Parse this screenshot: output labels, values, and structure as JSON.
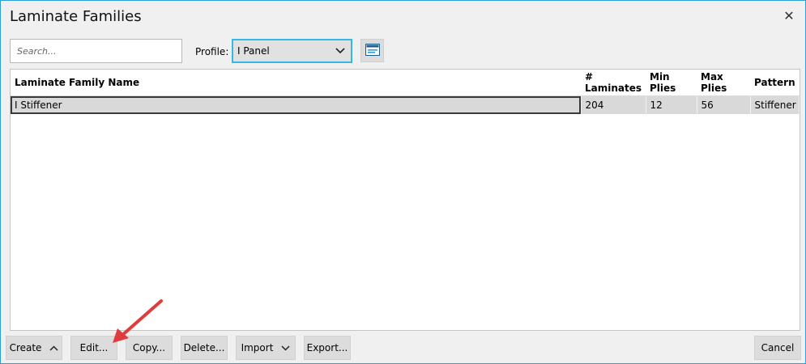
{
  "window": {
    "title": "Laminate Families"
  },
  "toolbar": {
    "search_placeholder": "Search...",
    "profile_label": "Profile:",
    "profile_value": "I Panel"
  },
  "table": {
    "columns": [
      "Laminate Family Name",
      "# Laminates",
      "Min Plies",
      "Max Plies",
      "Pattern"
    ],
    "rows": [
      {
        "name": "I Stiffener",
        "laminates": "204",
        "min_plies": "12",
        "max_plies": "56",
        "pattern": "Stiffener"
      }
    ]
  },
  "buttons": {
    "create": "Create",
    "edit": "Edit...",
    "copy": "Copy...",
    "delete": "Delete...",
    "import": "Import",
    "export": "Export...",
    "cancel": "Cancel"
  },
  "colors": {
    "accent": "#35b8e6",
    "annotation_arrow": "#e03c3c"
  },
  "icons": [
    "close-icon",
    "chevron-down-icon",
    "panel-view-icon",
    "chevron-up-icon"
  ]
}
